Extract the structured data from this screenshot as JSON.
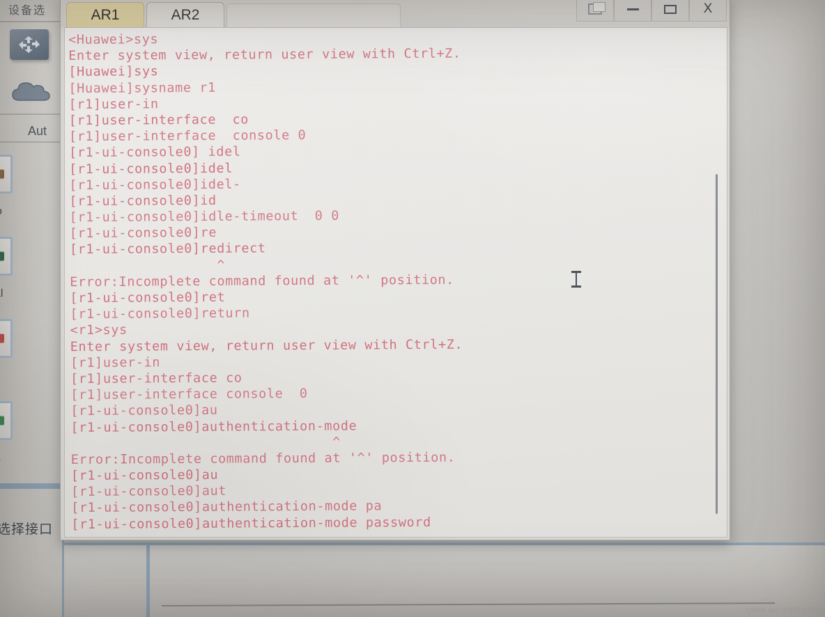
{
  "app": {
    "sidebar_title": "设备选",
    "sidebar_section_label": "Aut",
    "bottom_status_label": "选择接口",
    "device_icons": [
      {
        "name": "router-icon",
        "label": ""
      },
      {
        "name": "cloud-icon",
        "label": ""
      }
    ],
    "device_thumbs": [
      {
        "caption": "o"
      },
      {
        "caption": "al"
      },
      {
        "caption": ""
      },
      {
        "caption": "L"
      }
    ]
  },
  "window": {
    "tabs": [
      {
        "label": "AR1",
        "active": true
      },
      {
        "label": "AR2",
        "active": false
      }
    ],
    "buttons": {
      "copy": "",
      "minimize": "—",
      "maximize": "",
      "close": "X"
    }
  },
  "terminal": {
    "lines": [
      "<Huawei>sys",
      "Enter system view, return user view with Ctrl+Z.",
      "[Huawei]sys",
      "[Huawei]sysname r1",
      "[r1]user-in",
      "[r1]user-interface  co",
      "[r1]user-interface  console 0",
      "[r1-ui-console0] idel",
      "[r1-ui-console0]idel",
      "[r1-ui-console0]idel-",
      "[r1-ui-console0]id",
      "[r1-ui-console0]idle-timeout  0 0",
      "[r1-ui-console0]re",
      "[r1-ui-console0]redirect",
      "                  ^",
      "Error:Incomplete command found at '^' position.",
      "[r1-ui-console0]ret",
      "[r1-ui-console0]return",
      "<r1>sys",
      "Enter system view, return user view with Ctrl+Z.",
      "[r1]user-in",
      "[r1]user-interface co",
      "[r1]user-interface console  0",
      "[r1-ui-console0]au",
      "[r1-ui-console0]authentication-mode",
      "                                ^",
      "Error:Incomplete command found at '^' position.",
      "[r1-ui-console0]au",
      "[r1-ui-console0]aut",
      "[r1-ui-console0]authentication-mode pa",
      "[r1-ui-console0]authentication-mode password"
    ]
  },
  "colors": {
    "terminal_text": "#d1707e",
    "terminal_bg": "#eceae7",
    "active_tab": "#e2d5a6",
    "frame_accent": "#8ea3b4"
  },
  "watermark": {
    "text": "CSDN @心之所向的南墙"
  }
}
